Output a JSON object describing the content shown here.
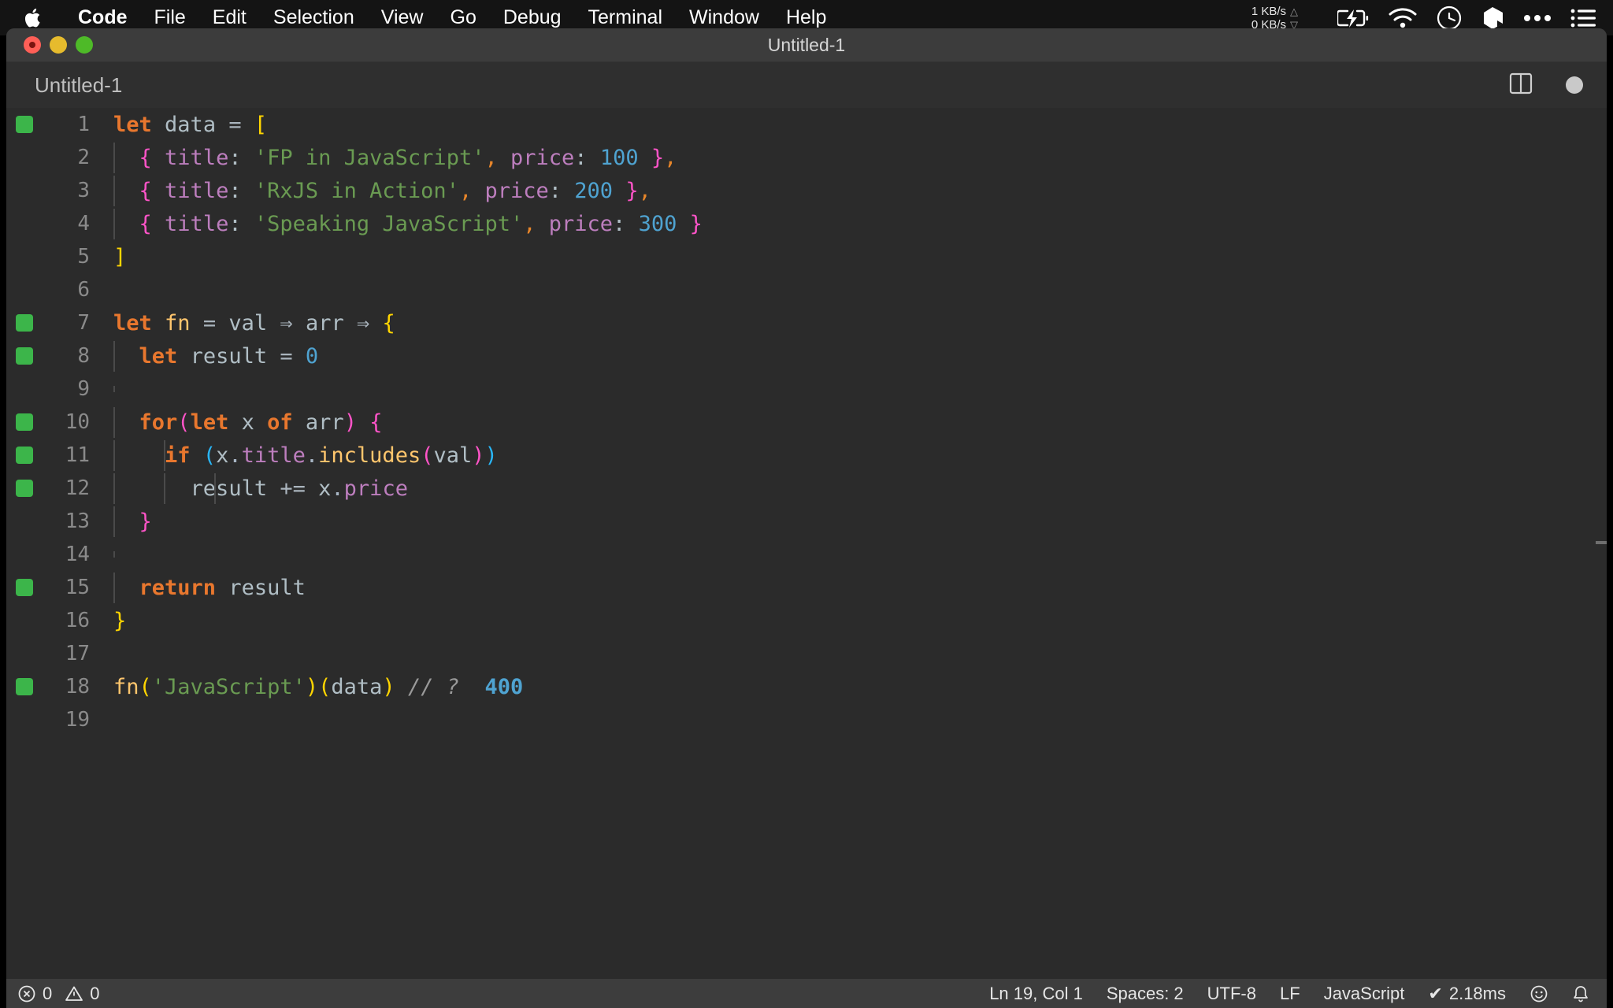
{
  "menubar": {
    "apple_icon": "apple-logo-icon",
    "items": [
      {
        "label": "Code",
        "bold": true
      },
      {
        "label": "File",
        "bold": false
      },
      {
        "label": "Edit",
        "bold": false
      },
      {
        "label": "Selection",
        "bold": false
      },
      {
        "label": "View",
        "bold": false
      },
      {
        "label": "Go",
        "bold": false
      },
      {
        "label": "Debug",
        "bold": false
      },
      {
        "label": "Terminal",
        "bold": false
      },
      {
        "label": "Window",
        "bold": false
      },
      {
        "label": "Help",
        "bold": false
      }
    ],
    "network": {
      "upload": "1 KB/s",
      "download": "0 KB/s",
      "up_arrow": "△",
      "down_arrow": "▽"
    },
    "tray_icons": [
      "battery-charging-icon",
      "wifi-icon",
      "clock-icon",
      "dropbox-icon",
      "ellipsis-icon",
      "control-center-list-icon"
    ]
  },
  "window": {
    "title": "Untitled-1",
    "traffic_lights": [
      "close-button",
      "minimize-button",
      "zoom-button"
    ]
  },
  "tabbar": {
    "tab_label": "Untitled-1",
    "split_editor_icon": "split-editor-icon",
    "unsaved_dot": "unsaved-changes-dot"
  },
  "editor": {
    "lines": [
      {
        "n": "1",
        "quokka": true,
        "indent": 0,
        "tokens": [
          {
            "t": "let",
            "c": "t-kw"
          },
          {
            "t": " ",
            "c": "t-punc"
          },
          {
            "t": "data",
            "c": "t-var"
          },
          {
            "t": " ",
            "c": "t-punc"
          },
          {
            "t": "=",
            "c": "t-op"
          },
          {
            "t": " ",
            "c": "t-punc"
          },
          {
            "t": "[",
            "c": "t-br-y"
          }
        ]
      },
      {
        "n": "2",
        "quokka": false,
        "indent": 1,
        "tokens": [
          {
            "t": "  ",
            "c": "t-punc"
          },
          {
            "t": "{",
            "c": "t-br-m"
          },
          {
            "t": " ",
            "c": "t-punc"
          },
          {
            "t": "title",
            "c": "t-prop"
          },
          {
            "t": ":",
            "c": "t-colon"
          },
          {
            "t": " ",
            "c": "t-punc"
          },
          {
            "t": "'FP in JavaScript'",
            "c": "t-str"
          },
          {
            "t": ",",
            "c": "t-comma"
          },
          {
            "t": " ",
            "c": "t-punc"
          },
          {
            "t": "price",
            "c": "t-prop"
          },
          {
            "t": ":",
            "c": "t-colon"
          },
          {
            "t": " ",
            "c": "t-punc"
          },
          {
            "t": "100",
            "c": "t-num"
          },
          {
            "t": " ",
            "c": "t-punc"
          },
          {
            "t": "}",
            "c": "t-br-m"
          },
          {
            "t": ",",
            "c": "t-comma"
          }
        ]
      },
      {
        "n": "3",
        "quokka": false,
        "indent": 1,
        "tokens": [
          {
            "t": "  ",
            "c": "t-punc"
          },
          {
            "t": "{",
            "c": "t-br-m"
          },
          {
            "t": " ",
            "c": "t-punc"
          },
          {
            "t": "title",
            "c": "t-prop"
          },
          {
            "t": ":",
            "c": "t-colon"
          },
          {
            "t": " ",
            "c": "t-punc"
          },
          {
            "t": "'RxJS in Action'",
            "c": "t-str"
          },
          {
            "t": ",",
            "c": "t-comma"
          },
          {
            "t": " ",
            "c": "t-punc"
          },
          {
            "t": "price",
            "c": "t-prop"
          },
          {
            "t": ":",
            "c": "t-colon"
          },
          {
            "t": " ",
            "c": "t-punc"
          },
          {
            "t": "200",
            "c": "t-num"
          },
          {
            "t": " ",
            "c": "t-punc"
          },
          {
            "t": "}",
            "c": "t-br-m"
          },
          {
            "t": ",",
            "c": "t-comma"
          }
        ]
      },
      {
        "n": "4",
        "quokka": false,
        "indent": 1,
        "tokens": [
          {
            "t": "  ",
            "c": "t-punc"
          },
          {
            "t": "{",
            "c": "t-br-m"
          },
          {
            "t": " ",
            "c": "t-punc"
          },
          {
            "t": "title",
            "c": "t-prop"
          },
          {
            "t": ":",
            "c": "t-colon"
          },
          {
            "t": " ",
            "c": "t-punc"
          },
          {
            "t": "'Speaking JavaScript'",
            "c": "t-str"
          },
          {
            "t": ",",
            "c": "t-comma"
          },
          {
            "t": " ",
            "c": "t-punc"
          },
          {
            "t": "price",
            "c": "t-prop"
          },
          {
            "t": ":",
            "c": "t-colon"
          },
          {
            "t": " ",
            "c": "t-punc"
          },
          {
            "t": "300",
            "c": "t-num"
          },
          {
            "t": " ",
            "c": "t-punc"
          },
          {
            "t": "}",
            "c": "t-br-m"
          }
        ]
      },
      {
        "n": "5",
        "quokka": false,
        "indent": 0,
        "tokens": [
          {
            "t": "]",
            "c": "t-br-y"
          }
        ]
      },
      {
        "n": "6",
        "quokka": false,
        "indent": 0,
        "tokens": []
      },
      {
        "n": "7",
        "quokka": true,
        "indent": 0,
        "tokens": [
          {
            "t": "let",
            "c": "t-kw"
          },
          {
            "t": " ",
            "c": "t-punc"
          },
          {
            "t": "fn",
            "c": "t-fn"
          },
          {
            "t": " ",
            "c": "t-punc"
          },
          {
            "t": "=",
            "c": "t-op"
          },
          {
            "t": " ",
            "c": "t-punc"
          },
          {
            "t": "val",
            "c": "t-var"
          },
          {
            "t": " ",
            "c": "t-punc"
          },
          {
            "t": "⇒",
            "c": "t-op"
          },
          {
            "t": " ",
            "c": "t-punc"
          },
          {
            "t": "arr",
            "c": "t-var"
          },
          {
            "t": " ",
            "c": "t-punc"
          },
          {
            "t": "⇒",
            "c": "t-op"
          },
          {
            "t": " ",
            "c": "t-punc"
          },
          {
            "t": "{",
            "c": "t-br-y"
          }
        ]
      },
      {
        "n": "8",
        "quokka": true,
        "indent": 1,
        "tokens": [
          {
            "t": "  ",
            "c": "t-punc"
          },
          {
            "t": "let",
            "c": "t-kw"
          },
          {
            "t": " ",
            "c": "t-punc"
          },
          {
            "t": "result",
            "c": "t-var"
          },
          {
            "t": " ",
            "c": "t-punc"
          },
          {
            "t": "=",
            "c": "t-op"
          },
          {
            "t": " ",
            "c": "t-punc"
          },
          {
            "t": "0",
            "c": "t-num"
          }
        ]
      },
      {
        "n": "9",
        "quokka": false,
        "indent": 1,
        "tokens": []
      },
      {
        "n": "10",
        "quokka": true,
        "indent": 1,
        "tokens": [
          {
            "t": "  ",
            "c": "t-punc"
          },
          {
            "t": "for",
            "c": "t-kw"
          },
          {
            "t": "(",
            "c": "t-br-m"
          },
          {
            "t": "let",
            "c": "t-kw"
          },
          {
            "t": " ",
            "c": "t-punc"
          },
          {
            "t": "x",
            "c": "t-var"
          },
          {
            "t": " ",
            "c": "t-punc"
          },
          {
            "t": "of",
            "c": "t-kw"
          },
          {
            "t": " ",
            "c": "t-punc"
          },
          {
            "t": "arr",
            "c": "t-var"
          },
          {
            "t": ")",
            "c": "t-br-m"
          },
          {
            "t": " ",
            "c": "t-punc"
          },
          {
            "t": "{",
            "c": "t-br-m"
          }
        ]
      },
      {
        "n": "11",
        "quokka": true,
        "indent": 2,
        "tokens": [
          {
            "t": "    ",
            "c": "t-punc"
          },
          {
            "t": "if",
            "c": "t-kw"
          },
          {
            "t": " ",
            "c": "t-punc"
          },
          {
            "t": "(",
            "c": "t-br-c"
          },
          {
            "t": "x",
            "c": "t-var"
          },
          {
            "t": ".",
            "c": "t-punc"
          },
          {
            "t": "title",
            "c": "t-prop"
          },
          {
            "t": ".",
            "c": "t-punc"
          },
          {
            "t": "includes",
            "c": "t-fn"
          },
          {
            "t": "(",
            "c": "t-br-m"
          },
          {
            "t": "val",
            "c": "t-var"
          },
          {
            "t": ")",
            "c": "t-br-m"
          },
          {
            "t": ")",
            "c": "t-br-c"
          }
        ]
      },
      {
        "n": "12",
        "quokka": true,
        "indent": 3,
        "tokens": [
          {
            "t": "      ",
            "c": "t-punc"
          },
          {
            "t": "result",
            "c": "t-var"
          },
          {
            "t": " ",
            "c": "t-punc"
          },
          {
            "t": "+=",
            "c": "t-op"
          },
          {
            "t": " ",
            "c": "t-punc"
          },
          {
            "t": "x",
            "c": "t-var"
          },
          {
            "t": ".",
            "c": "t-punc"
          },
          {
            "t": "price",
            "c": "t-prop"
          }
        ]
      },
      {
        "n": "13",
        "quokka": false,
        "indent": 1,
        "tokens": [
          {
            "t": "  ",
            "c": "t-punc"
          },
          {
            "t": "}",
            "c": "t-br-m"
          }
        ]
      },
      {
        "n": "14",
        "quokka": false,
        "indent": 1,
        "tokens": []
      },
      {
        "n": "15",
        "quokka": true,
        "indent": 1,
        "tokens": [
          {
            "t": "  ",
            "c": "t-punc"
          },
          {
            "t": "return",
            "c": "t-kw"
          },
          {
            "t": " ",
            "c": "t-punc"
          },
          {
            "t": "result",
            "c": "t-var"
          }
        ]
      },
      {
        "n": "16",
        "quokka": false,
        "indent": 0,
        "tokens": [
          {
            "t": "}",
            "c": "t-br-y"
          }
        ]
      },
      {
        "n": "17",
        "quokka": false,
        "indent": 0,
        "tokens": []
      },
      {
        "n": "18",
        "quokka": true,
        "indent": 0,
        "tokens": [
          {
            "t": "fn",
            "c": "t-fn"
          },
          {
            "t": "(",
            "c": "t-br-y"
          },
          {
            "t": "'JavaScript'",
            "c": "t-str"
          },
          {
            "t": ")",
            "c": "t-br-y"
          },
          {
            "t": "(",
            "c": "t-br-y"
          },
          {
            "t": "data",
            "c": "t-var"
          },
          {
            "t": ")",
            "c": "t-br-y"
          },
          {
            "t": " ",
            "c": "t-punc"
          },
          {
            "t": "// ?",
            "c": "t-com"
          },
          {
            "t": "  ",
            "c": "t-punc"
          },
          {
            "t": "400",
            "c": "t-quok"
          }
        ]
      },
      {
        "n": "19",
        "quokka": false,
        "indent": 0,
        "tokens": []
      }
    ]
  },
  "statusbar": {
    "errors_icon": "error-circle-icon",
    "errors": "0",
    "warnings_icon": "warning-triangle-icon",
    "warnings": "0",
    "cursor_position": "Ln 19, Col 1",
    "indentation": "Spaces: 2",
    "encoding": "UTF-8",
    "eol": "LF",
    "language": "JavaScript",
    "quokka_check": "✔",
    "quokka_time": "2.18ms",
    "smiley_icon": "feedback-smiley-icon",
    "bell_icon": "notifications-bell-icon"
  },
  "colors": {
    "menubar_bg": "#141414",
    "titlebar_bg": "#3c3c3c",
    "editor_bg": "#2b2b2b",
    "statusbar_bg": "#3d3d3d",
    "quokka_green": "#3cb54a",
    "keyword_orange": "#e8772e",
    "string_green": "#6a9b52",
    "number_blue": "#4fa3d1",
    "property_purple": "#bd7ebe",
    "bracket_yellow": "#ffd500",
    "bracket_magenta": "#ff54c8"
  }
}
